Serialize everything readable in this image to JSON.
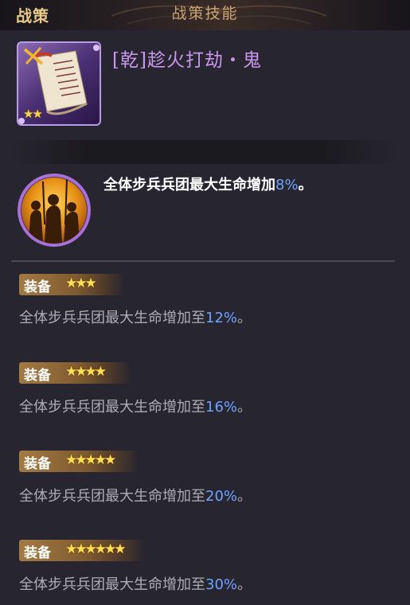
{
  "header": {
    "title": "战策"
  },
  "card": {
    "name": "[乾]趁火打劫・鬼",
    "stars": "★★"
  },
  "skill": {
    "section_title": "战策技能",
    "desc_prefix": "全体步兵兵团最大生命增加",
    "value": "8%",
    "desc_suffix": "。"
  },
  "equips": [
    {
      "label": "装备",
      "stars": "★★★",
      "desc_prefix": "全体步兵兵团最大生命增加至",
      "value": "12%",
      "suffix": "。"
    },
    {
      "label": "装备",
      "stars": "★★★★",
      "desc_prefix": "全体步兵兵团最大生命增加至",
      "value": "16%",
      "suffix": "。"
    },
    {
      "label": "装备",
      "stars": "★★★★★",
      "desc_prefix": "全体步兵兵团最大生命增加至",
      "value": "20%",
      "suffix": "。"
    },
    {
      "label": "装备",
      "stars": "★★★★★★",
      "desc_prefix": "全体步兵兵团最大生命增加至",
      "value": "30%",
      "suffix": "。"
    }
  ],
  "colors": {
    "title": "#e8c98a",
    "name": "#c896ee",
    "highlight": "#6fa3ff",
    "frame": "#b99be2"
  }
}
